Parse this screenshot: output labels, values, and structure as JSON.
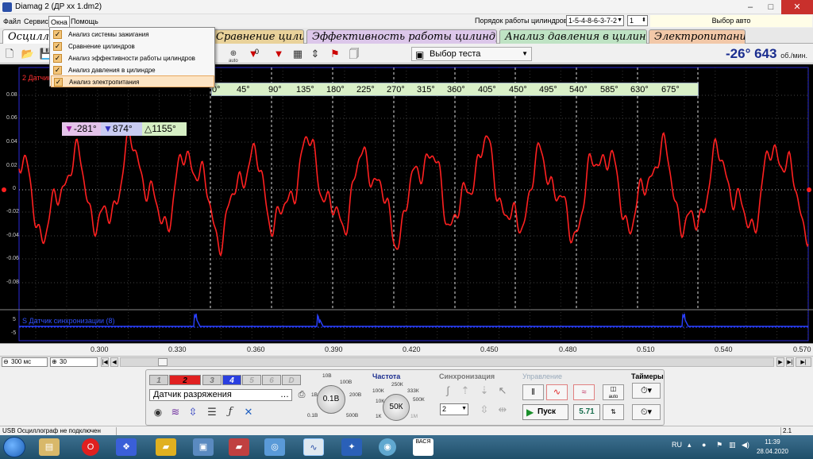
{
  "window": {
    "title": "Diamag 2 (ДР хх 1.dm2)",
    "minimize": "–",
    "maximize": "□",
    "close": "✕"
  },
  "menu": {
    "file": "Файл",
    "service": "Сервис",
    "windows": "Окна",
    "help": "Помощь"
  },
  "cylinder_order": {
    "label": "Порядок работы цилиндров",
    "value": "1-5-4-8-6-3-7-2",
    "cylinder": "1"
  },
  "auto_select": "Выбор авто",
  "tabs": [
    {
      "label": "Осциллограф"
    },
    {
      "label": "Сравнение цилиндров"
    },
    {
      "label": "Эффективность работы цилиндров"
    },
    {
      "label": "Анализ давления в цилиндре"
    },
    {
      "label": "Электропитание"
    }
  ],
  "windows_menu": [
    {
      "label": "Анализ системы зажигания",
      "checked": true
    },
    {
      "label": "Сравнение цилиндров",
      "checked": true
    },
    {
      "label": "Анализ эффективности работы цилиндров",
      "checked": true
    },
    {
      "label": "Анализ давления в цилиндре",
      "checked": true
    },
    {
      "label": "Анализ электропитания",
      "checked": true,
      "highlighted": true
    }
  ],
  "toolbar": {
    "test_select": "Выбор теста",
    "auto_label": "auto",
    "zero_label": "0"
  },
  "rpm": {
    "value": "-26° 643",
    "unit": "об./мин."
  },
  "scope": {
    "channel2_label": "2 Датчик разряжения",
    "sync_label": "S Датчик синхронизации (8)",
    "y_ticks": [
      "0.08",
      "0.06",
      "0.04",
      "0.02",
      "0",
      "-0.02",
      "-0.04",
      "-0.06",
      "-0.08"
    ],
    "sync_ticks": [
      "5",
      "-5"
    ],
    "degrees": [
      "0°",
      "45°",
      "90°",
      "135°",
      "180°",
      "225°",
      "270°",
      "315°",
      "360°",
      "405°",
      "450°",
      "495°",
      "540°",
      "585°",
      "630°",
      "675°"
    ],
    "cursor_a": "-281°",
    "cursor_b": "874°",
    "delta": "1155°",
    "trace_color": "#ff2020",
    "sync_color": "#2a40ff"
  },
  "x_axis": [
    "0.300",
    "0.330",
    "0.360",
    "0.390",
    "0.420",
    "0.450",
    "0.480",
    "0.510",
    "0.540",
    "0.570"
  ],
  "scroll": {
    "time_scale": "300 мс",
    "zoom": "30"
  },
  "panel": {
    "channels": [
      "1",
      "2",
      "3",
      "4",
      "5",
      "6",
      "D"
    ],
    "sensor": "Датчик разряжения",
    "voltage": {
      "value": "0.1В",
      "marks": [
        "10В",
        "100В",
        "1В",
        "200В",
        "0.1В",
        "500В"
      ]
    },
    "frequency": {
      "title": "Частота",
      "value": "50К",
      "marks": [
        "250К",
        "100К",
        "333К",
        "10К",
        "500К",
        "1К",
        "1М"
      ]
    },
    "sync": {
      "title": "Синхронизация",
      "value": "2"
    },
    "control": {
      "title": "Управление",
      "run": "Пуск",
      "value": "5.71",
      "auto": "auto"
    },
    "timers": {
      "title": "Таймеры"
    }
  },
  "status": {
    "left": "USB Осциллограф не подключен",
    "right": "2.1"
  },
  "taskbar": {
    "lang": "RU",
    "time": "11:39",
    "date": "28.04.2020"
  }
}
